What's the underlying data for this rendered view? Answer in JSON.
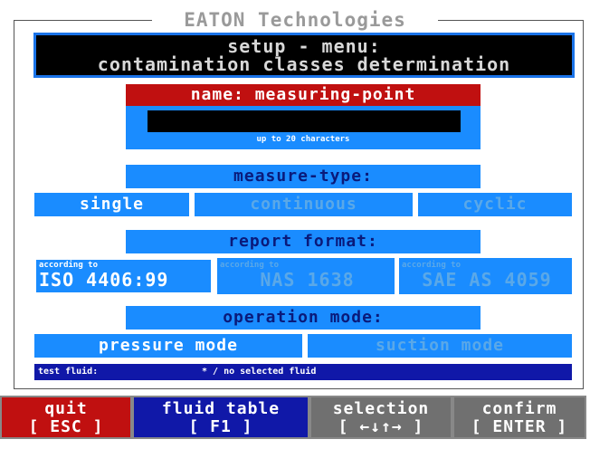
{
  "brand": "EATON Technologies",
  "title": {
    "line1": "setup - menu:",
    "line2": "contamination classes determination"
  },
  "name_section": {
    "header": "name: measuring-point",
    "value": "",
    "hint": "up to 20 characters"
  },
  "measure_type": {
    "header": "measure-type:",
    "options": [
      "single",
      "continuous",
      "cyclic"
    ],
    "selected": "single"
  },
  "report_format": {
    "header": "report format:",
    "options": [
      {
        "prefix": "according to",
        "label": "ISO 4406:99"
      },
      {
        "prefix": "according to",
        "label": "NAS 1638"
      },
      {
        "prefix": "according to",
        "label": "SAE AS 4059"
      }
    ],
    "selected": "ISO 4406:99"
  },
  "operation_mode": {
    "header": "operation mode:",
    "options": [
      "pressure mode",
      "suction mode"
    ],
    "selected": "pressure mode"
  },
  "fluid": {
    "label": "test fluid:",
    "value": "* / no selected fluid"
  },
  "function_keys": [
    {
      "label": "quit",
      "key": "[ ESC ]",
      "color": "#c01010"
    },
    {
      "label": "fluid table",
      "key": "[ F1 ]",
      "color": "#1018a8"
    },
    {
      "label": "selection",
      "key": "[ ←↓↑→ ]",
      "color": "#707070"
    },
    {
      "label": "confirm",
      "key": "[ ENTER ]",
      "color": "#707070"
    }
  ],
  "colors": {
    "accent_blue": "#1a8cff",
    "title_bg": "#000000",
    "name_header_bg": "#c01010"
  }
}
